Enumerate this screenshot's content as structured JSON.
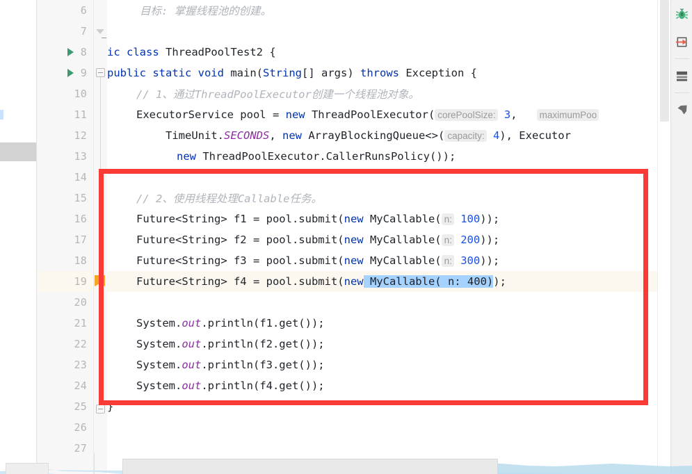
{
  "app": {
    "kind": "java-code-editor",
    "accent_red": "#fa3a35",
    "keyword_color": "#0033b3",
    "number_color": "#1750eb",
    "comment_color": "#b0b4bb",
    "static_color": "#8a2f9e",
    "selection_color": "#a6d2ff",
    "current_line_color": "#fdf8ef",
    "bookmark_color": "#f5a623",
    "run_arrow_color": "#3c9a6e"
  },
  "gutter": {
    "line_numbers": [
      "6",
      "7",
      "8",
      "9",
      "10",
      "11",
      "12",
      "13",
      "14",
      "15",
      "16",
      "17",
      "18",
      "19",
      "20",
      "21",
      "22",
      "23",
      "24",
      "25",
      "26",
      "27"
    ],
    "run_arrow_lines": [
      "8",
      "9"
    ],
    "current_line": "19",
    "bookmark_line": "19"
  },
  "code": {
    "lines": [
      {
        "n": "6",
        "tokens": [
          {
            "t": "cmt",
            "s": "目标: 掌握线程池的创建。"
          }
        ]
      },
      {
        "n": "7",
        "tokens": []
      },
      {
        "n": "8",
        "tokens": [
          {
            "t": "kw",
            "s": "ic"
          },
          {
            "t": "plain",
            "s": " "
          },
          {
            "t": "kw",
            "s": "class"
          },
          {
            "t": "plain",
            "s": " ThreadPoolTest2 {"
          }
        ]
      },
      {
        "n": "9",
        "tokens": [
          {
            "t": "kw",
            "s": "public static void"
          },
          {
            "t": "plain",
            "s": " "
          },
          {
            "t": "type",
            "s": "main"
          },
          {
            "t": "plain",
            "s": "("
          },
          {
            "t": "kw",
            "s": "String"
          },
          {
            "t": "plain",
            "s": "[] args) "
          },
          {
            "t": "kw",
            "s": "throws"
          },
          {
            "t": "plain",
            "s": " Exception {"
          }
        ]
      },
      {
        "n": "10",
        "tokens": [
          {
            "t": "cmt",
            "s": "// 1、通过ThreadPoolExecutor创建一个线程池对象。"
          }
        ]
      },
      {
        "n": "11",
        "tokens": [
          {
            "t": "plain",
            "s": "ExecutorService pool = "
          },
          {
            "t": "kw",
            "s": "new"
          },
          {
            "t": "plain",
            "s": " ThreadPoolExecutor("
          },
          {
            "t": "hint",
            "s": "corePoolSize:"
          },
          {
            "t": "plain",
            "s": " "
          },
          {
            "t": "num",
            "s": "3"
          },
          {
            "t": "plain",
            "s": ",   "
          },
          {
            "t": "hint",
            "s": "maximumPoo"
          }
        ]
      },
      {
        "n": "12",
        "tokens": [
          {
            "t": "plain",
            "s": "TimeUnit."
          },
          {
            "t": "static",
            "s": "SECONDS"
          },
          {
            "t": "plain",
            "s": ", "
          },
          {
            "t": "kw",
            "s": "new"
          },
          {
            "t": "plain",
            "s": " ArrayBlockingQueue<>("
          },
          {
            "t": "hint",
            "s": "capacity:"
          },
          {
            "t": "plain",
            "s": " "
          },
          {
            "t": "num",
            "s": "4"
          },
          {
            "t": "plain",
            "s": "), Executor"
          }
        ]
      },
      {
        "n": "13",
        "tokens": [
          {
            "t": "kw",
            "s": "new"
          },
          {
            "t": "plain",
            "s": " ThreadPoolExecutor.CallerRunsPolicy());"
          }
        ]
      },
      {
        "n": "14",
        "tokens": []
      },
      {
        "n": "15",
        "tokens": [
          {
            "t": "cmt",
            "s": "// 2、使用线程处理Callable任务。"
          }
        ]
      },
      {
        "n": "16",
        "tokens": [
          {
            "t": "plain",
            "s": "Future<String> f1 = pool.submit("
          },
          {
            "t": "kw",
            "s": "new"
          },
          {
            "t": "plain",
            "s": " MyCallable("
          },
          {
            "t": "hint",
            "s": "n:"
          },
          {
            "t": "plain",
            "s": " "
          },
          {
            "t": "num",
            "s": "100"
          },
          {
            "t": "plain",
            "s": "));"
          }
        ]
      },
      {
        "n": "17",
        "tokens": [
          {
            "t": "plain",
            "s": "Future<String> f2 = pool.submit("
          },
          {
            "t": "kw",
            "s": "new"
          },
          {
            "t": "plain",
            "s": " MyCallable("
          },
          {
            "t": "hint",
            "s": "n:"
          },
          {
            "t": "plain",
            "s": " "
          },
          {
            "t": "num",
            "s": "200"
          },
          {
            "t": "plain",
            "s": "));"
          }
        ]
      },
      {
        "n": "18",
        "tokens": [
          {
            "t": "plain",
            "s": "Future<String> f3 = pool.submit("
          },
          {
            "t": "kw",
            "s": "new"
          },
          {
            "t": "plain",
            "s": " MyCallable("
          },
          {
            "t": "hint",
            "s": "n:"
          },
          {
            "t": "plain",
            "s": " "
          },
          {
            "t": "num",
            "s": "300"
          },
          {
            "t": "plain",
            "s": "));"
          }
        ]
      },
      {
        "n": "19",
        "tokens": [
          {
            "t": "plain",
            "s": "Future<String> f4 = pool.submit("
          },
          {
            "t": "kw",
            "s": "new"
          },
          {
            "t": "sel",
            "s": " MyCallable( n: 400)"
          },
          {
            "t": "plain",
            "s": ");"
          }
        ]
      },
      {
        "n": "20",
        "tokens": []
      },
      {
        "n": "21",
        "tokens": [
          {
            "t": "plain",
            "s": "System."
          },
          {
            "t": "static",
            "s": "out"
          },
          {
            "t": "plain",
            "s": ".println(f1.get());"
          }
        ]
      },
      {
        "n": "22",
        "tokens": [
          {
            "t": "plain",
            "s": "System."
          },
          {
            "t": "static",
            "s": "out"
          },
          {
            "t": "plain",
            "s": ".println(f2.get());"
          }
        ]
      },
      {
        "n": "23",
        "tokens": [
          {
            "t": "plain",
            "s": "System."
          },
          {
            "t": "static",
            "s": "out"
          },
          {
            "t": "plain",
            "s": ".println(f3.get());"
          }
        ]
      },
      {
        "n": "24",
        "tokens": [
          {
            "t": "plain",
            "s": "System."
          },
          {
            "t": "static",
            "s": "out"
          },
          {
            "t": "plain",
            "s": ".println(f4.get());"
          }
        ]
      },
      {
        "n": "25",
        "tokens": [
          {
            "t": "plain",
            "s": "}"
          }
        ]
      },
      {
        "n": "26",
        "tokens": []
      },
      {
        "n": "27",
        "tokens": []
      }
    ],
    "line19_selection": "MyCallable( n: 400)"
  },
  "tools": {
    "items": [
      {
        "name": "debug-bug-icon",
        "label": "Debug"
      },
      {
        "name": "step-arrow-icon",
        "label": "Step Into"
      },
      {
        "name": "variables-icon",
        "label": "Variables"
      },
      {
        "name": "pin-icon",
        "label": "Pin"
      }
    ]
  },
  "annotation": {
    "shape": "rectangle",
    "color": "#fa3a35",
    "covers_lines": "14-24"
  }
}
